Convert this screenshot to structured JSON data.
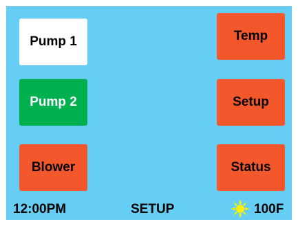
{
  "buttons": {
    "pump1": "Pump 1",
    "pump2": "Pump 2",
    "blower": "Blower",
    "temp": "Temp",
    "setup": "Setup",
    "status": "Status"
  },
  "status_bar": {
    "time": "12:00PM",
    "mode": "SETUP",
    "weather_icon": "sun-icon",
    "temperature": "100F"
  },
  "colors": {
    "background": "#66cdf4",
    "pump1_bg": "#ffffff",
    "pump2_bg": "#00b04f",
    "orange_bg": "#f2582b",
    "sun": "#fff200"
  }
}
